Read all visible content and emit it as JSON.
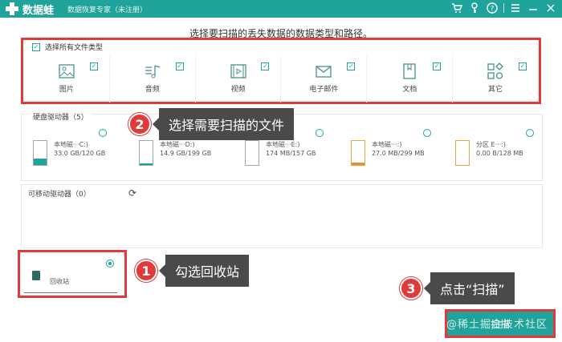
{
  "app": {
    "name": "数据蛙",
    "subtitle": "数据恢复专家（未注册）"
  },
  "instruction": "选择要扫描的丢失数据的数据类型和路径。",
  "file_types": {
    "select_all_label": "选择所有文件类型",
    "items": [
      {
        "label": "图片",
        "icon": "image-icon",
        "checked": true
      },
      {
        "label": "音频",
        "icon": "music-icon",
        "checked": true
      },
      {
        "label": "视频",
        "icon": "video-icon",
        "checked": true
      },
      {
        "label": "电子邮件",
        "icon": "email-icon",
        "checked": true
      },
      {
        "label": "文档",
        "icon": "document-icon",
        "checked": true
      },
      {
        "label": "其它",
        "icon": "other-icon",
        "checked": true
      }
    ]
  },
  "hard_drives": {
    "title": "硬盘驱动器（5）",
    "items": [
      {
        "name": "本地磁···C:)",
        "size": "33.0 GB/120 GB",
        "fill_fraction": 0.28
      },
      {
        "name": "本地磁···D:)",
        "size": "14.9 GB/199 GB",
        "fill_fraction": 0.08
      },
      {
        "name": "本地磁···E:)",
        "size": "174 MB/157 GB",
        "fill_fraction": 0.0
      },
      {
        "name": "本地磁···:)",
        "size": "27.0 MB/299 MB",
        "fill_fraction": 0.09
      },
      {
        "name": "分区 E···:)",
        "size": "0.00  B/128 MB",
        "fill_fraction": 0.0
      }
    ]
  },
  "removable": {
    "title": "可移动驱动器（0）"
  },
  "recycle_bin": {
    "label": "回收站",
    "selected": true
  },
  "scan_button": "扫描",
  "watermark": "@稀土掘金技术社区",
  "callouts": [
    {
      "number": "2",
      "text": "选择需要扫描的文件"
    },
    {
      "number": "1",
      "text": "勾选回收站"
    },
    {
      "number": "3",
      "text": "点击“扫描”"
    }
  ],
  "colors": {
    "accent": "#1fa39a",
    "highlight": "#e03a3a",
    "callout_bg": "#4a4a4a"
  }
}
